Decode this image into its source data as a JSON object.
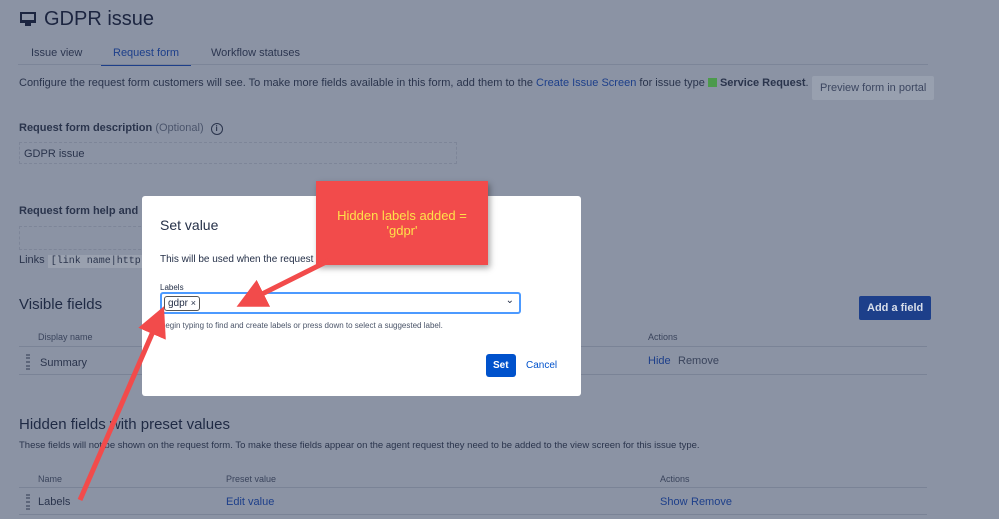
{
  "header": {
    "title": "GDPR issue"
  },
  "tabs": [
    {
      "label": "Issue view"
    },
    {
      "label": "Request form"
    },
    {
      "label": "Workflow statuses"
    }
  ],
  "intro": {
    "text": "Configure the request form customers will see. To make more fields available in this form, add them to the",
    "link": "Create Issue Screen",
    "text2": "for issue type",
    "issue_type": "Service Request"
  },
  "preview_button": "Preview form in portal",
  "description": {
    "label": "Request form description",
    "optional": "(Optional)",
    "value": "GDPR issue"
  },
  "help": {
    "label": "Request form help and ins",
    "links_label": "Links",
    "links_code": "[link name|http://"
  },
  "visible_fields": {
    "title": "Visible fields",
    "add_button": "Add a field",
    "col_display": "Display name",
    "col_actions": "Actions",
    "rows": [
      {
        "name": "Summary",
        "hide": "Hide",
        "remove": "Remove"
      }
    ]
  },
  "hidden_fields": {
    "title": "Hidden fields with preset values",
    "desc": "These fields will not be shown on the request form. To make these fields appear on the agent request they need to be added to the view screen for this issue type.",
    "col_name": "Name",
    "col_preset": "Preset value",
    "col_actions": "Actions",
    "rows": [
      {
        "name": "Labels",
        "preset": "Edit value",
        "show": "Show",
        "remove": "Remove"
      }
    ]
  },
  "modal": {
    "title": "Set value",
    "desc": "This will be used when the request",
    "field_label": "Labels",
    "tag": "gdpr",
    "helper": "Begin typing to find and create labels or press down to select a suggested label.",
    "set": "Set",
    "cancel": "Cancel"
  },
  "callout": {
    "line1": "Hidden labels added =",
    "line2": "'gdpr'"
  },
  "colors": {
    "accent": "#0052cc",
    "callout": "#f24b4b",
    "callout_text": "#ffe14a"
  }
}
